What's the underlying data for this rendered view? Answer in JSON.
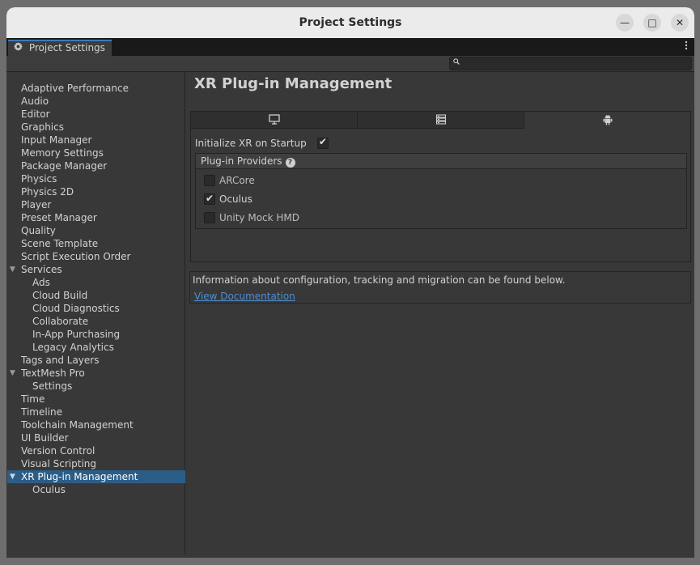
{
  "window": {
    "title": "Project Settings",
    "minimize_glyph": "—",
    "maximize_glyph": "□",
    "close_glyph": "✕"
  },
  "tab": {
    "label": "Project Settings",
    "icon": "gear-icon"
  },
  "search": {
    "placeholder": "",
    "value": ""
  },
  "sidebar": {
    "items": [
      {
        "label": "Adaptive Performance",
        "level": 0
      },
      {
        "label": "Audio",
        "level": 0
      },
      {
        "label": "Editor",
        "level": 0
      },
      {
        "label": "Graphics",
        "level": 0
      },
      {
        "label": "Input Manager",
        "level": 0
      },
      {
        "label": "Memory Settings",
        "level": 0
      },
      {
        "label": "Package Manager",
        "level": 0
      },
      {
        "label": "Physics",
        "level": 0
      },
      {
        "label": "Physics 2D",
        "level": 0
      },
      {
        "label": "Player",
        "level": 0
      },
      {
        "label": "Preset Manager",
        "level": 0
      },
      {
        "label": "Quality",
        "level": 0
      },
      {
        "label": "Scene Template",
        "level": 0
      },
      {
        "label": "Script Execution Order",
        "level": 0
      },
      {
        "label": "Services",
        "level": 0,
        "expanded": true
      },
      {
        "label": "Ads",
        "level": 1
      },
      {
        "label": "Cloud Build",
        "level": 1
      },
      {
        "label": "Cloud Diagnostics",
        "level": 1
      },
      {
        "label": "Collaborate",
        "level": 1
      },
      {
        "label": "In-App Purchasing",
        "level": 1
      },
      {
        "label": "Legacy Analytics",
        "level": 1
      },
      {
        "label": "Tags and Layers",
        "level": 0
      },
      {
        "label": "TextMesh Pro",
        "level": 0,
        "expanded": true
      },
      {
        "label": "Settings",
        "level": 1
      },
      {
        "label": "Time",
        "level": 0
      },
      {
        "label": "Timeline",
        "level": 0
      },
      {
        "label": "Toolchain Management",
        "level": 0
      },
      {
        "label": "UI Builder",
        "level": 0
      },
      {
        "label": "Version Control",
        "level": 0
      },
      {
        "label": "Visual Scripting",
        "level": 0
      },
      {
        "label": "XR Plug-in Management",
        "level": 0,
        "expanded": true,
        "selected": true
      },
      {
        "label": "Oculus",
        "level": 1
      }
    ]
  },
  "main": {
    "title": "XR Plug-in Management",
    "platform_tabs": [
      {
        "icon": "desktop-icon",
        "active": false
      },
      {
        "icon": "server-icon",
        "active": false
      },
      {
        "icon": "android-icon",
        "active": true
      }
    ],
    "initialize_label": "Initialize XR on Startup",
    "initialize_checked": true,
    "providers_title": "Plug-in Providers",
    "help_glyph": "?",
    "providers": [
      {
        "label": "ARCore",
        "checked": false
      },
      {
        "label": "Oculus",
        "checked": true
      },
      {
        "label": "Unity Mock HMD",
        "checked": false
      }
    ],
    "info_text": "Information about configuration, tracking and migration can be found below.",
    "info_link": "View Documentation"
  },
  "colors": {
    "selection": "#2c5d87",
    "panel_bg": "#383838",
    "link": "#4e8ecf",
    "tab_accent": "#3a79bb"
  }
}
